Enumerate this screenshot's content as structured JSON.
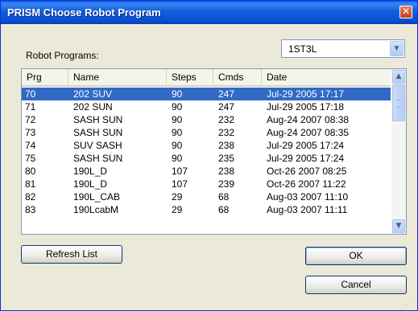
{
  "window": {
    "title": "PRISM Choose Robot Program",
    "close_symbol": "✕"
  },
  "label_programs": "Robot Programs:",
  "robot_select": {
    "value": "1ST3L"
  },
  "columns": [
    "Prg",
    "Name",
    "Steps",
    "Cmds",
    "Date"
  ],
  "rows": [
    {
      "prg": "70",
      "name": "202 SUV",
      "steps": "90",
      "cmds": "247",
      "date": "Jul-29  2005  17:17",
      "selected": true
    },
    {
      "prg": "71",
      "name": "202 SUN",
      "steps": "90",
      "cmds": "247",
      "date": "Jul-29  2005  17:18"
    },
    {
      "prg": "72",
      "name": "SASH SUN",
      "steps": "90",
      "cmds": "232",
      "date": "Aug-24  2007  08:38"
    },
    {
      "prg": "73",
      "name": "SASH SUN",
      "steps": "90",
      "cmds": "232",
      "date": "Aug-24  2007  08:35"
    },
    {
      "prg": "74",
      "name": "SUV SASH",
      "steps": "90",
      "cmds": "238",
      "date": "Jul-29  2005  17:24"
    },
    {
      "prg": "75",
      "name": "SASH SUN",
      "steps": "90",
      "cmds": "235",
      "date": "Jul-29  2005  17:24"
    },
    {
      "prg": "80",
      "name": "190L_D",
      "steps": "107",
      "cmds": "238",
      "date": "Oct-26  2007  08:25"
    },
    {
      "prg": "81",
      "name": "190L_D",
      "steps": "107",
      "cmds": "239",
      "date": "Oct-26  2007  11:22"
    },
    {
      "prg": "82",
      "name": "190L_CAB",
      "steps": "29",
      "cmds": "68",
      "date": "Aug-03  2007  11:10"
    },
    {
      "prg": "83",
      "name": "190LcabM",
      "steps": "29",
      "cmds": "68",
      "date": "Aug-03  2007  11:11"
    }
  ],
  "buttons": {
    "refresh": "Refresh List",
    "ok": "OK",
    "cancel": "Cancel"
  }
}
